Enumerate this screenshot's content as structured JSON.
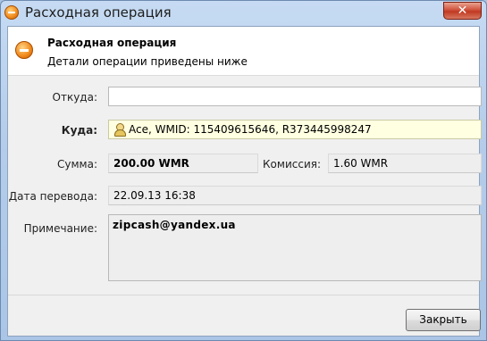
{
  "window": {
    "title": "Расходная операция",
    "close_glyph": "✕"
  },
  "header": {
    "title": "Расходная операция",
    "subtitle": "Детали операции приведены ниже"
  },
  "form": {
    "from_label": "Откуда:",
    "from_value": "",
    "to_label": "Куда:",
    "to_value": "Ace, WMID: 115409615646, R373445998247",
    "amount_label": "Сумма:",
    "amount_value": "200.00 WMR",
    "commission_label": "Комиссия:",
    "commission_value": "1.60 WMR",
    "date_label": "Дата перевода:",
    "date_value": "22.09.13 16:38",
    "note_label": "Примечание:",
    "note_value": "zipcash@yandex.ua"
  },
  "footer": {
    "close_label": "Закрыть"
  },
  "icons": {
    "title": "minus-circle-icon",
    "header": "minus-circle-icon",
    "recipient": "user-icon"
  },
  "colors": {
    "accent_orange": "#f08a1c",
    "close_red": "#c03a22",
    "recipient_bg": "#ffffe1"
  }
}
